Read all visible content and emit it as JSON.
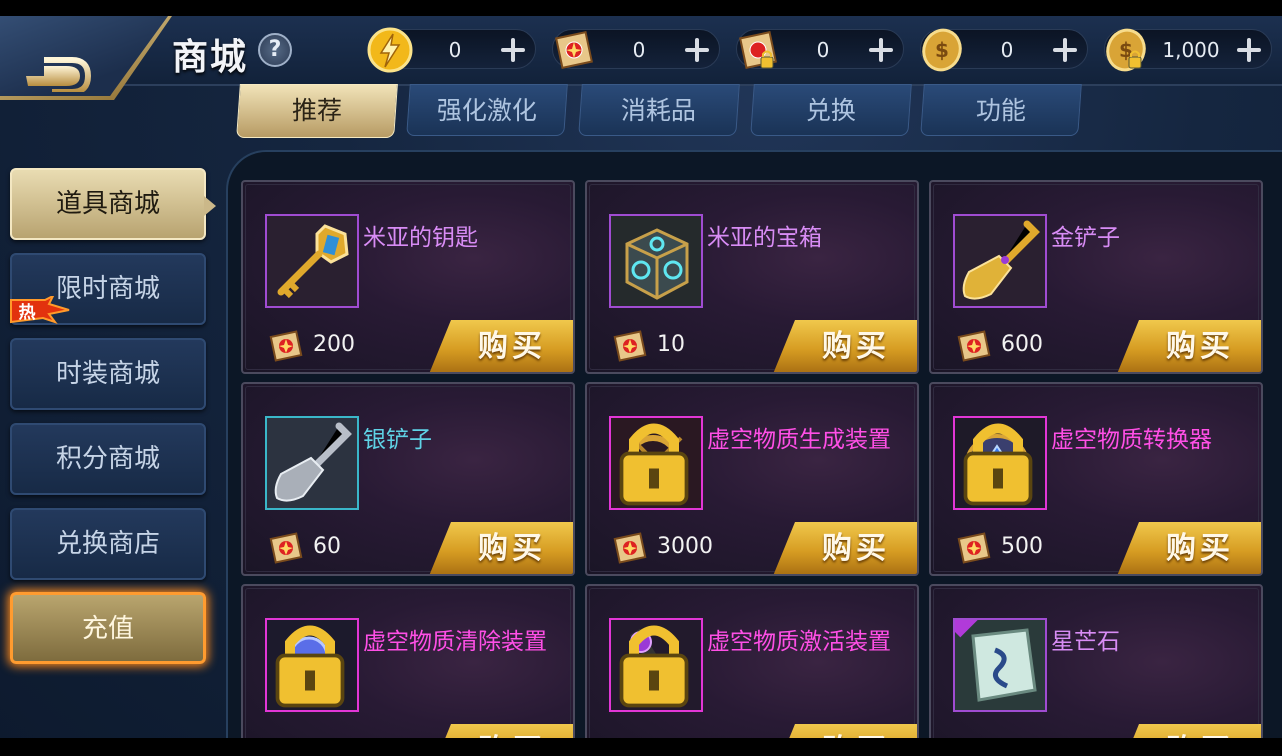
{
  "header": {
    "title": "商城",
    "help_label": "?"
  },
  "currencies": [
    {
      "icon": "lightning-coin-icon",
      "value": "0"
    },
    {
      "icon": "scroll-ticket-icon",
      "value": "0"
    },
    {
      "icon": "locked-scroll-ticket-icon",
      "value": "0"
    },
    {
      "icon": "gold-coin-icon",
      "value": "0"
    },
    {
      "icon": "locked-gold-coin-icon",
      "value": "1,000"
    }
  ],
  "tabs": [
    {
      "label": "推荐",
      "active": true
    },
    {
      "label": "强化激化",
      "active": false
    },
    {
      "label": "消耗品",
      "active": false
    },
    {
      "label": "兑换",
      "active": false
    },
    {
      "label": "功能",
      "active": false
    }
  ],
  "sidebar": {
    "items": [
      {
        "label": "道具商城",
        "active": true
      },
      {
        "label": "限时商城",
        "active": false,
        "badge": "热"
      },
      {
        "label": "时装商城",
        "active": false
      },
      {
        "label": "积分商城",
        "active": false
      },
      {
        "label": "兑换商店",
        "active": false
      },
      {
        "label": "充值",
        "active": false
      }
    ]
  },
  "shop": {
    "buy_label": "购买",
    "items": [
      {
        "name": "米亚的钥匙",
        "price": "200",
        "name_color": "#d88cf5",
        "locked": false
      },
      {
        "name": "米亚的宝箱",
        "price": "10",
        "name_color": "#d88cf5",
        "locked": false
      },
      {
        "name": "金铲子",
        "price": "600",
        "name_color": "#d88cf5",
        "locked": false
      },
      {
        "name": "银铲子",
        "price": "60",
        "name_color": "#5fd3e6",
        "locked": false
      },
      {
        "name": "虚空物质生成装置",
        "price": "3000",
        "name_color": "#ff4fe6",
        "locked": true
      },
      {
        "name": "虚空物质转换器",
        "price": "500",
        "name_color": "#ff4fe6",
        "locked": true
      },
      {
        "name": "虚空物质清除装置",
        "price": "",
        "name_color": "#ff4fe6",
        "locked": true
      },
      {
        "name": "虚空物质激活装置",
        "price": "",
        "name_color": "#ff4fe6",
        "locked": true
      },
      {
        "name": "星芒石",
        "price": "",
        "name_color": "#d88cf5",
        "locked": false
      }
    ]
  },
  "colors": {
    "accent_gold": "#d69c22",
    "tab_active": "#e9dcb2",
    "panel_bg": "#0c1726"
  }
}
